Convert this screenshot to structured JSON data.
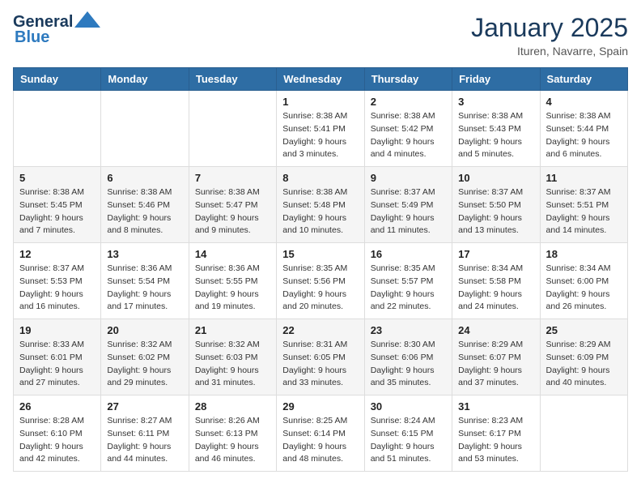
{
  "logo": {
    "line1": "General",
    "line2": "Blue"
  },
  "title": "January 2025",
  "subtitle": "Ituren, Navarre, Spain",
  "headers": [
    "Sunday",
    "Monday",
    "Tuesday",
    "Wednesday",
    "Thursday",
    "Friday",
    "Saturday"
  ],
  "weeks": [
    [
      {
        "day": "",
        "sunrise": "",
        "sunset": "",
        "daylight": ""
      },
      {
        "day": "",
        "sunrise": "",
        "sunset": "",
        "daylight": ""
      },
      {
        "day": "",
        "sunrise": "",
        "sunset": "",
        "daylight": ""
      },
      {
        "day": "1",
        "sunrise": "Sunrise: 8:38 AM",
        "sunset": "Sunset: 5:41 PM",
        "daylight": "Daylight: 9 hours and 3 minutes."
      },
      {
        "day": "2",
        "sunrise": "Sunrise: 8:38 AM",
        "sunset": "Sunset: 5:42 PM",
        "daylight": "Daylight: 9 hours and 4 minutes."
      },
      {
        "day": "3",
        "sunrise": "Sunrise: 8:38 AM",
        "sunset": "Sunset: 5:43 PM",
        "daylight": "Daylight: 9 hours and 5 minutes."
      },
      {
        "day": "4",
        "sunrise": "Sunrise: 8:38 AM",
        "sunset": "Sunset: 5:44 PM",
        "daylight": "Daylight: 9 hours and 6 minutes."
      }
    ],
    [
      {
        "day": "5",
        "sunrise": "Sunrise: 8:38 AM",
        "sunset": "Sunset: 5:45 PM",
        "daylight": "Daylight: 9 hours and 7 minutes."
      },
      {
        "day": "6",
        "sunrise": "Sunrise: 8:38 AM",
        "sunset": "Sunset: 5:46 PM",
        "daylight": "Daylight: 9 hours and 8 minutes."
      },
      {
        "day": "7",
        "sunrise": "Sunrise: 8:38 AM",
        "sunset": "Sunset: 5:47 PM",
        "daylight": "Daylight: 9 hours and 9 minutes."
      },
      {
        "day": "8",
        "sunrise": "Sunrise: 8:38 AM",
        "sunset": "Sunset: 5:48 PM",
        "daylight": "Daylight: 9 hours and 10 minutes."
      },
      {
        "day": "9",
        "sunrise": "Sunrise: 8:37 AM",
        "sunset": "Sunset: 5:49 PM",
        "daylight": "Daylight: 9 hours and 11 minutes."
      },
      {
        "day": "10",
        "sunrise": "Sunrise: 8:37 AM",
        "sunset": "Sunset: 5:50 PM",
        "daylight": "Daylight: 9 hours and 13 minutes."
      },
      {
        "day": "11",
        "sunrise": "Sunrise: 8:37 AM",
        "sunset": "Sunset: 5:51 PM",
        "daylight": "Daylight: 9 hours and 14 minutes."
      }
    ],
    [
      {
        "day": "12",
        "sunrise": "Sunrise: 8:37 AM",
        "sunset": "Sunset: 5:53 PM",
        "daylight": "Daylight: 9 hours and 16 minutes."
      },
      {
        "day": "13",
        "sunrise": "Sunrise: 8:36 AM",
        "sunset": "Sunset: 5:54 PM",
        "daylight": "Daylight: 9 hours and 17 minutes."
      },
      {
        "day": "14",
        "sunrise": "Sunrise: 8:36 AM",
        "sunset": "Sunset: 5:55 PM",
        "daylight": "Daylight: 9 hours and 19 minutes."
      },
      {
        "day": "15",
        "sunrise": "Sunrise: 8:35 AM",
        "sunset": "Sunset: 5:56 PM",
        "daylight": "Daylight: 9 hours and 20 minutes."
      },
      {
        "day": "16",
        "sunrise": "Sunrise: 8:35 AM",
        "sunset": "Sunset: 5:57 PM",
        "daylight": "Daylight: 9 hours and 22 minutes."
      },
      {
        "day": "17",
        "sunrise": "Sunrise: 8:34 AM",
        "sunset": "Sunset: 5:58 PM",
        "daylight": "Daylight: 9 hours and 24 minutes."
      },
      {
        "day": "18",
        "sunrise": "Sunrise: 8:34 AM",
        "sunset": "Sunset: 6:00 PM",
        "daylight": "Daylight: 9 hours and 26 minutes."
      }
    ],
    [
      {
        "day": "19",
        "sunrise": "Sunrise: 8:33 AM",
        "sunset": "Sunset: 6:01 PM",
        "daylight": "Daylight: 9 hours and 27 minutes."
      },
      {
        "day": "20",
        "sunrise": "Sunrise: 8:32 AM",
        "sunset": "Sunset: 6:02 PM",
        "daylight": "Daylight: 9 hours and 29 minutes."
      },
      {
        "day": "21",
        "sunrise": "Sunrise: 8:32 AM",
        "sunset": "Sunset: 6:03 PM",
        "daylight": "Daylight: 9 hours and 31 minutes."
      },
      {
        "day": "22",
        "sunrise": "Sunrise: 8:31 AM",
        "sunset": "Sunset: 6:05 PM",
        "daylight": "Daylight: 9 hours and 33 minutes."
      },
      {
        "day": "23",
        "sunrise": "Sunrise: 8:30 AM",
        "sunset": "Sunset: 6:06 PM",
        "daylight": "Daylight: 9 hours and 35 minutes."
      },
      {
        "day": "24",
        "sunrise": "Sunrise: 8:29 AM",
        "sunset": "Sunset: 6:07 PM",
        "daylight": "Daylight: 9 hours and 37 minutes."
      },
      {
        "day": "25",
        "sunrise": "Sunrise: 8:29 AM",
        "sunset": "Sunset: 6:09 PM",
        "daylight": "Daylight: 9 hours and 40 minutes."
      }
    ],
    [
      {
        "day": "26",
        "sunrise": "Sunrise: 8:28 AM",
        "sunset": "Sunset: 6:10 PM",
        "daylight": "Daylight: 9 hours and 42 minutes."
      },
      {
        "day": "27",
        "sunrise": "Sunrise: 8:27 AM",
        "sunset": "Sunset: 6:11 PM",
        "daylight": "Daylight: 9 hours and 44 minutes."
      },
      {
        "day": "28",
        "sunrise": "Sunrise: 8:26 AM",
        "sunset": "Sunset: 6:13 PM",
        "daylight": "Daylight: 9 hours and 46 minutes."
      },
      {
        "day": "29",
        "sunrise": "Sunrise: 8:25 AM",
        "sunset": "Sunset: 6:14 PM",
        "daylight": "Daylight: 9 hours and 48 minutes."
      },
      {
        "day": "30",
        "sunrise": "Sunrise: 8:24 AM",
        "sunset": "Sunset: 6:15 PM",
        "daylight": "Daylight: 9 hours and 51 minutes."
      },
      {
        "day": "31",
        "sunrise": "Sunrise: 8:23 AM",
        "sunset": "Sunset: 6:17 PM",
        "daylight": "Daylight: 9 hours and 53 minutes."
      },
      {
        "day": "",
        "sunrise": "",
        "sunset": "",
        "daylight": ""
      }
    ]
  ]
}
